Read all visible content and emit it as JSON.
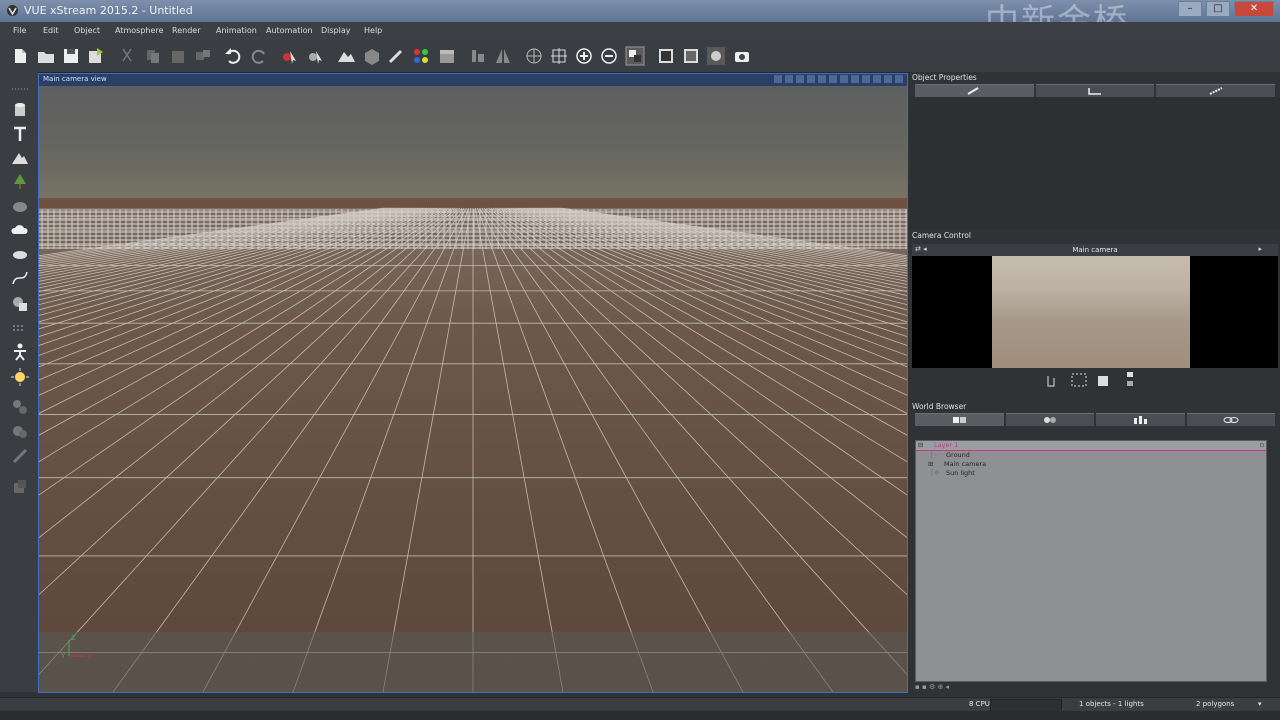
{
  "window": {
    "title": "VUE xStream 2015.2 - Untitled",
    "watermark": "中新金桥"
  },
  "menu": [
    "File",
    "Edit",
    "Object",
    "Atmosphere",
    "Render",
    "Animation",
    "Automation",
    "Display",
    "Help"
  ],
  "viewport": {
    "title": "Main camera view",
    "axis_labels": {
      "z": "Z",
      "y": "Y",
      "x": "X"
    }
  },
  "panels": {
    "object_properties": "Object Properties",
    "camera_control": "Camera Control",
    "camera_name": "Main camera",
    "world_browser": "World Browser"
  },
  "world_browser": {
    "items": [
      {
        "label": "Layer 1",
        "selected": true
      },
      {
        "label": "Ground"
      },
      {
        "label": "Main camera"
      },
      {
        "label": "Sun light"
      }
    ]
  },
  "status": {
    "cpu": "8 CPU",
    "objects": "1 objects - 1 lights",
    "polygons": "2 polygons"
  },
  "colors": {
    "accent": "#3d6fc4",
    "ground": "#5d4a3c",
    "selection": "#c23b7a"
  }
}
